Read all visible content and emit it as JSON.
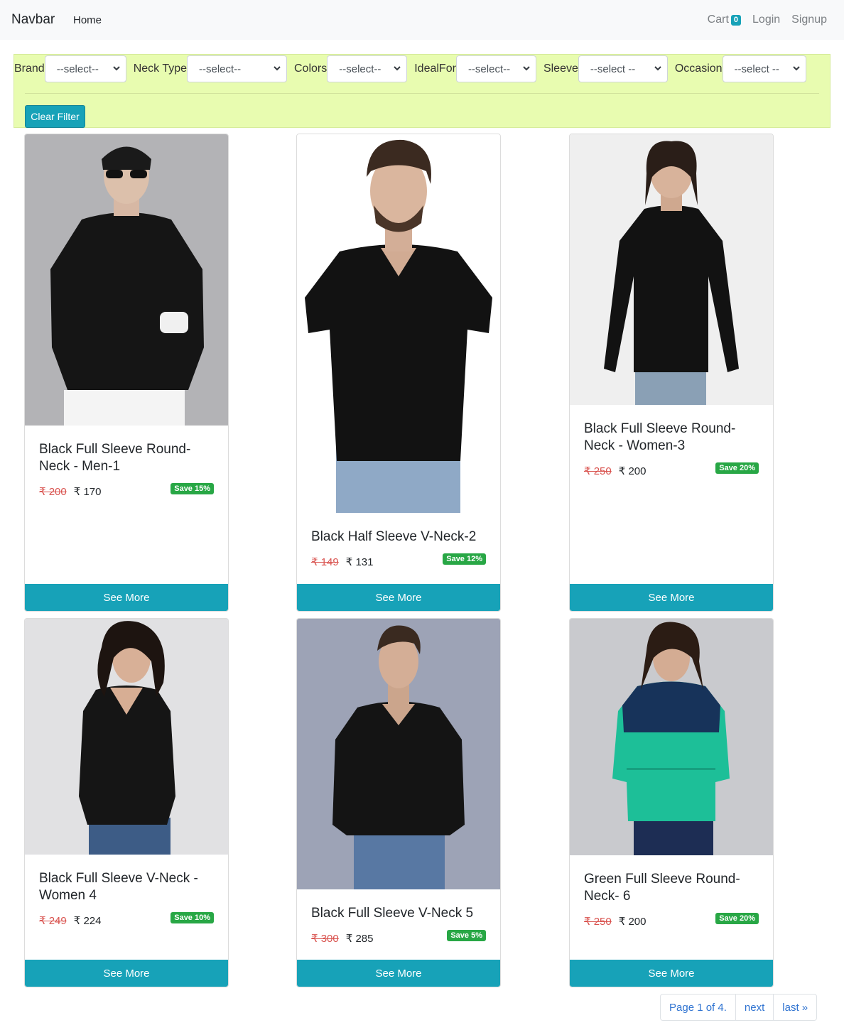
{
  "navbar": {
    "brand": "Navbar",
    "home": "Home",
    "cart_label": "Cart",
    "cart_count": "0",
    "login": "Login",
    "signup": "Signup"
  },
  "filters": [
    {
      "label": "Brand",
      "value": "--select--"
    },
    {
      "label": "Neck Type",
      "value": "--select--"
    },
    {
      "label": "Colors",
      "value": "--select--"
    },
    {
      "label": "IdealFor",
      "value": "--select--"
    },
    {
      "label": "Sleeve",
      "value": "--select --"
    },
    {
      "label": "Occasion",
      "value": "--select --"
    }
  ],
  "clear_filter": "Clear Filter",
  "products": [
    {
      "title": "Black Full Sleeve Round-Neck - Men-1",
      "old_price": "₹ 200",
      "price": "₹ 170",
      "save": "Save 15%",
      "button": "See More"
    },
    {
      "title": "Black Half Sleeve V-Neck-2",
      "old_price": "₹ 149",
      "price": "₹ 131",
      "save": "Save 12%",
      "button": "See More"
    },
    {
      "title": "Black Full Sleeve Round-Neck - Women-3",
      "old_price": "₹ 250",
      "price": "₹ 200",
      "save": "Save 20%",
      "button": "See More"
    },
    {
      "title": "Black Full Sleeve V-Neck - Women 4",
      "old_price": "₹ 249",
      "price": "₹ 224",
      "save": "Save 10%",
      "button": "See More"
    },
    {
      "title": "Black Full Sleeve V-Neck 5",
      "old_price": "₹ 300",
      "price": "₹ 285",
      "save": "Save 5%",
      "button": "See More"
    },
    {
      "title": "Green Full Sleeve Round-Neck- 6",
      "old_price": "₹ 250",
      "price": "₹ 200",
      "save": "Save 20%",
      "button": "See More"
    }
  ],
  "pagination": {
    "page_info": "Page 1 of 4.",
    "next": "next",
    "last": "last »"
  },
  "colors": {
    "accent": "#17a2b8",
    "filter_bg": "#e8fcb0",
    "save_badge": "#28a745",
    "old_price": "#d9534f"
  }
}
